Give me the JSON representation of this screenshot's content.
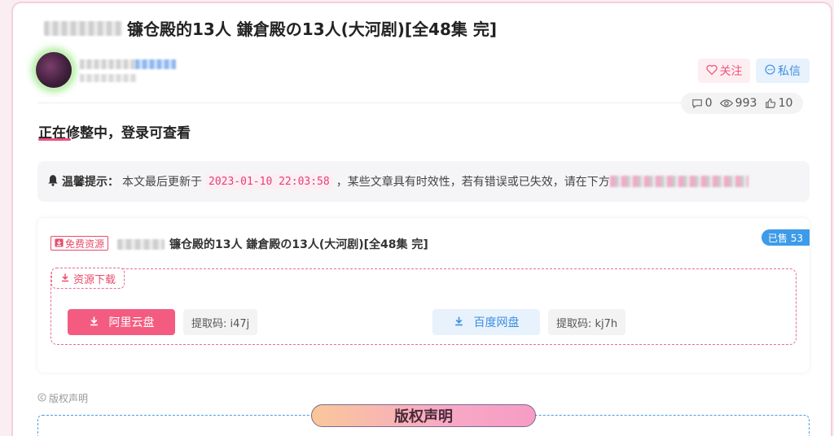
{
  "post": {
    "title": "镰仓殿的13人 鎌倉殿の13人(大河剧)[全48集 完]",
    "stats": {
      "comments": "0",
      "views": "993",
      "likes": "10"
    }
  },
  "author": {
    "follow_label": "关注",
    "message_label": "私信"
  },
  "notice": {
    "text": "正在修整中，登录可查看"
  },
  "tip": {
    "label": "温馨提示：",
    "prefix": "本文最后更新于",
    "date": "2023-01-10 22:03:58",
    "suffix": "，某些文章具有时效性，若有错误或已失效，请在下方"
  },
  "resource": {
    "badge": "免费资源",
    "title": "镰仓殿的13人 鎌倉殿の13人(大河剧)[全48集 完]",
    "sold": "已售 53",
    "download_label": "资源下载",
    "links": [
      {
        "name": "阿里云盘",
        "code": "提取码: i47j"
      },
      {
        "name": "百度网盘",
        "code": "提取码: kj7h"
      }
    ]
  },
  "copyright": {
    "small_label": "版权声明",
    "heading": "版权声明"
  },
  "colors": {
    "accent_pink": "#f35c80",
    "accent_blue": "#3d8fe0"
  },
  "icons": {
    "heart": "heart-icon",
    "message": "message-icon",
    "bell": "bell-icon",
    "download": "download-icon",
    "comment": "comment-icon",
    "eye": "eye-icon",
    "thumb": "thumb-up-icon",
    "copyright": "copyright-icon"
  }
}
